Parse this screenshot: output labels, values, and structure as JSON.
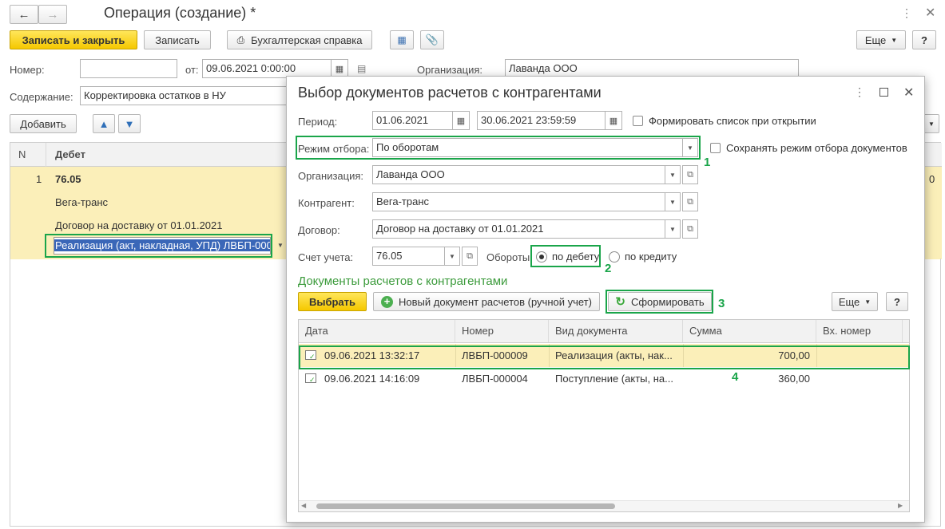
{
  "window": {
    "title": "Операция (создание) *"
  },
  "toolbar": {
    "save_close": "Записать и закрыть",
    "save": "Записать",
    "accounting_note": "Бухгалтерская справка",
    "more": "Еще",
    "help": "?"
  },
  "form": {
    "number_label": "Номер:",
    "number_value": "",
    "date_label": "от:",
    "date_value": "09.06.2021  0:00:00",
    "org_label": "Организация:",
    "org_value": "Лаванда ООО",
    "content_label": "Содержание:",
    "content_value": "Корректировка остатков в НУ",
    "add_button": "Добавить"
  },
  "main_table": {
    "col_n": "N",
    "col_debit": "Дебет",
    "row_number": "1",
    "account": "76.05",
    "subconto1": "Вега-транс",
    "subconto2": "Договор на доставку от 01.01.2021",
    "subconto3": "Реализация (акт, накладная, УПД) ЛВБП-000",
    "right_edge_value": "0"
  },
  "dialog": {
    "title": "Выбор документов расчетов с контрагентами",
    "period_label": "Период:",
    "period_from": "01.06.2021",
    "period_to": "30.06.2021 23:59:59",
    "form_on_open": "Формировать список при открытии",
    "mode_label": "Режим отбора:",
    "mode_value": "По оборотам",
    "save_mode": "Сохранять режим отбора документов",
    "org_label": "Организация:",
    "org_value": "Лаванда ООО",
    "counterparty_label": "Контрагент:",
    "counterparty_value": "Вега-транс",
    "contract_label": "Договор:",
    "contract_value": "Договор на доставку от 01.01.2021",
    "account_label": "Счет учета:",
    "account_value": "76.05",
    "turnover_label": "Обороты:",
    "radio_debit": "по дебету",
    "radio_credit": "по кредиту",
    "section_title": "Документы расчетов с контрагентами",
    "select_button": "Выбрать",
    "new_doc_button": "Новый документ расчетов (ручной учет)",
    "generate_button": "Сформировать",
    "more": "Еще",
    "help": "?",
    "table_headers": [
      "Дата",
      "Номер",
      "Вид документа",
      "Сумма",
      "Вх. номер"
    ],
    "rows": [
      {
        "date": "09.06.2021 13:32:17",
        "number": "ЛВБП-000009",
        "type": "Реализация (акты, нак...",
        "sum": "700,00",
        "in_number": ""
      },
      {
        "date": "09.06.2021 14:16:09",
        "number": "ЛВБП-000004",
        "type": "Поступление (акты, на...",
        "sum": "360,00",
        "in_number": ""
      }
    ]
  },
  "annotations": {
    "n1": "1",
    "n2": "2",
    "n3": "3",
    "n4": "4"
  },
  "colors": {
    "accent_yellow": "#f5c800",
    "selection_row": "#fbefb9",
    "annotation_green": "#1aa54a",
    "section_green": "#3c9b3c"
  }
}
